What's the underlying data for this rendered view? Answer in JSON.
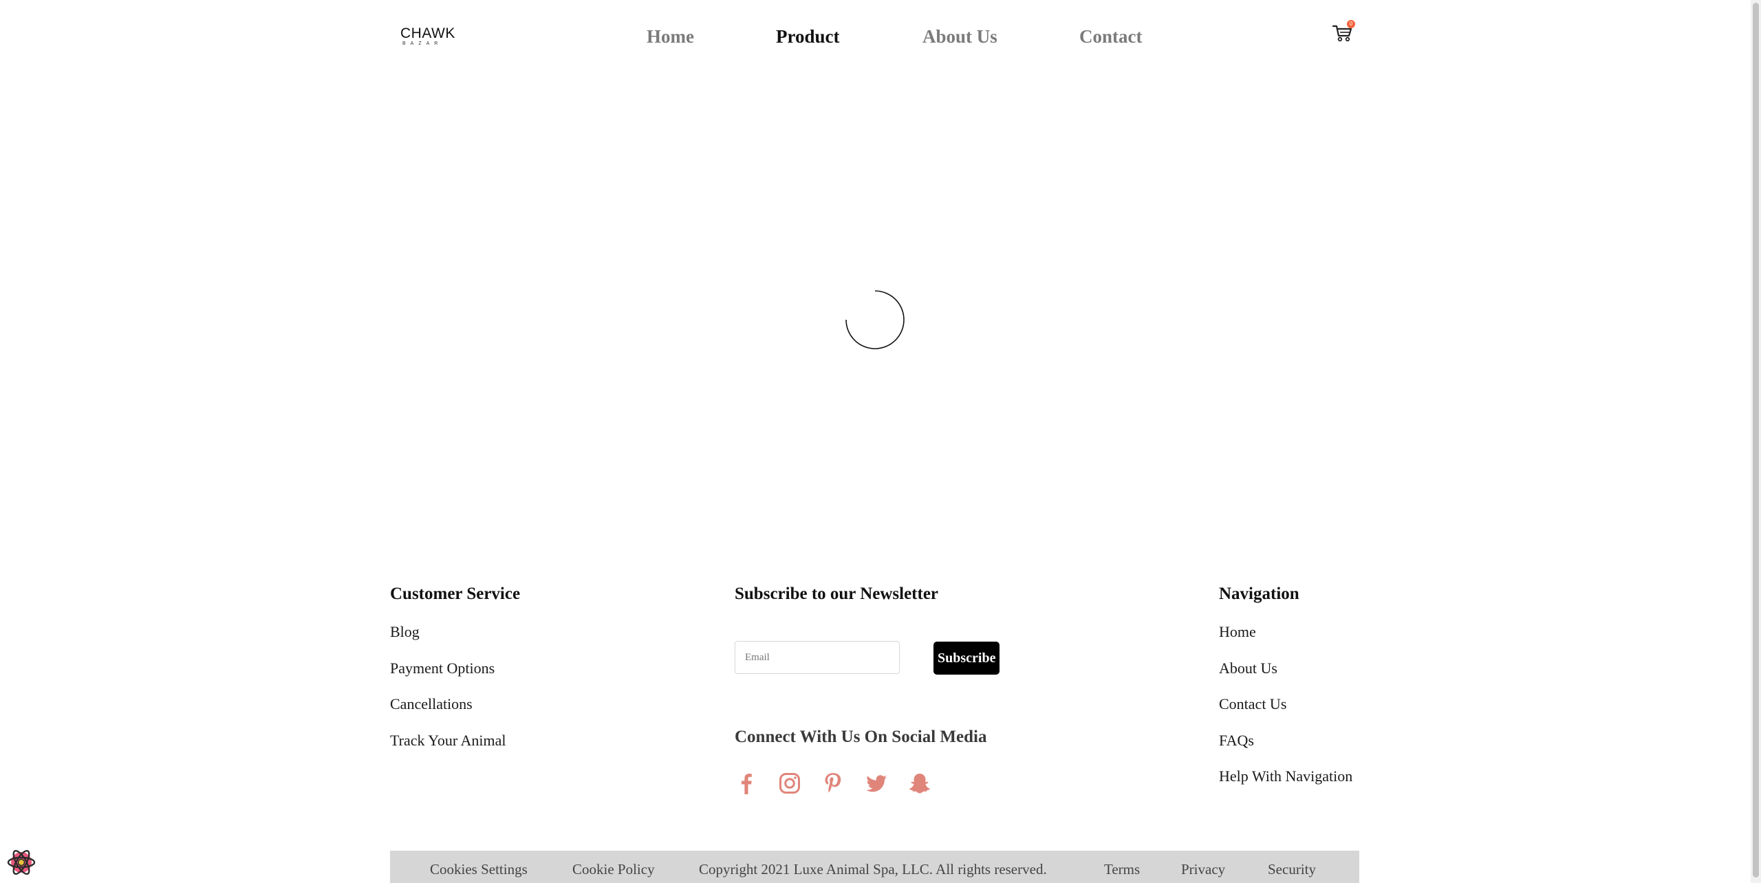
{
  "header": {
    "logo_main": "CHAWK",
    "logo_sub": "BAZAR",
    "nav": [
      "Home",
      "Product",
      "About Us",
      "Contact"
    ],
    "active_nav": "Product",
    "cart_count": "0",
    "cart_badge_color": "#f2623a"
  },
  "loader": {
    "icon": "loading-spinner"
  },
  "footer": {
    "customer_service": {
      "title": "Customer Service",
      "links": [
        "Blog",
        "Payment Options",
        "Cancellations",
        "Track Your Animal"
      ]
    },
    "newsletter": {
      "title": "Subscribe to our Newsletter",
      "email_placeholder": "Email",
      "subscribe_label": "Subscribe"
    },
    "social": {
      "title": "Connect With Us On Social Media",
      "icons": [
        "facebook-icon",
        "instagram-icon",
        "pinterest-icon",
        "twitter-icon",
        "snapchat-icon"
      ],
      "icon_color": "#e0857a"
    },
    "navigation": {
      "title": "Navigation",
      "links": [
        "Home",
        "About Us",
        "Contact Us",
        "FAQs",
        "Help With Navigation"
      ]
    },
    "bottom_bar": {
      "items": [
        "Cookies Settings",
        "Cookie Policy",
        "Copyright 2021 Luxe Animal Spa, LLC. All rights reserved.",
        "Terms",
        "Privacy",
        "Security"
      ]
    }
  }
}
